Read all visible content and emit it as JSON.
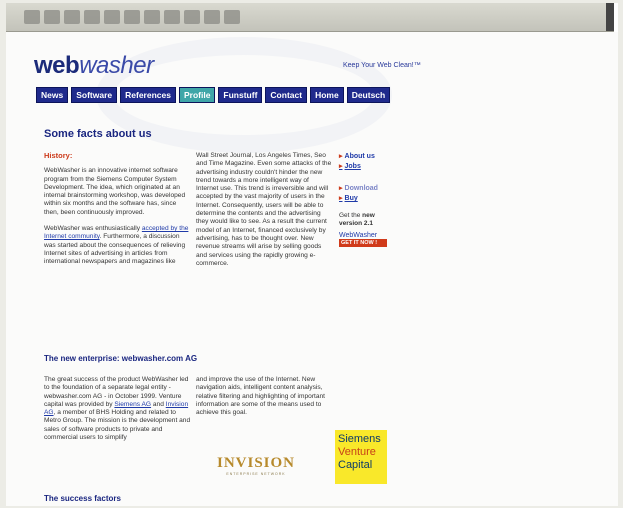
{
  "header": {
    "logo_main": "web",
    "logo_rest": "washer",
    "tagline": "Keep Your Web Clean!™"
  },
  "nav": [
    {
      "label": "News"
    },
    {
      "label": "Software"
    },
    {
      "label": "References"
    },
    {
      "label": "Profile",
      "active": true
    },
    {
      "label": "Funstuff"
    },
    {
      "label": "Contact"
    },
    {
      "label": "Home"
    },
    {
      "label": "Deutsch"
    }
  ],
  "main": {
    "heading": "Some facts about us",
    "history_title": "History:",
    "col1_p1": "WebWasher is an innovative internet software program from the Siemens Computer System Development. The idea, which originated at an internal brainstorming workshop, was developed within six months and the software has, since then, been continuously improved.",
    "col1_p2_start": "WebWasher was enthusiastically",
    "col1_p2_link": "accepted by the Internet community",
    "col1_p2_end": ". Furthermore, a discussion was started about the consequences of relieving Internet sites of advertising in articles from international newspapers and magazines like",
    "col2_p1": "Wall Street Journal, Los Angeles Times, Seo and Time Magazine. Even some attacks of the advertising industry couldn't hinder the new trend towards a more intelligent way of Internet use. This trend is irreversible and will accepted by the vast majority of users in the Internet. Consequently, users will be able to determine the contents and the advertising they would like to see. As a result the current model of an Internet, financed exclusively by advertising, has to be thought over. New revenue streams will arise by selling goods and services using the rapidly growing e-commerce."
  },
  "sidebar": {
    "items": [
      {
        "label": "About us"
      },
      {
        "label": "Jobs"
      },
      {
        "label": "Download"
      },
      {
        "label": "Buy"
      }
    ],
    "get_text_1": "Get the",
    "get_text_bold": "new version 2.1",
    "badge_name": "WebWasher",
    "badge_cta": "GET IT NOW !"
  },
  "section2": {
    "title": "The new enterprise: webwasher.com AG",
    "col1_start": "The great success of the product WebWasher led to the foundation of a separate legal entity - webwasher.com AG - in October 1999. Venture capital was provided by",
    "col1_link1": "Siemens AG",
    "col1_and": "and",
    "col1_link2": "Invision AG",
    "col1_end": ", a member of BHS Holding and related to Metro Group. The mission is the development and sales of software products to private and commercial users to simplify",
    "col2": "and improve the use of the Internet. New navigation aids, intelligent content analysis, relative filtering and highlighting of important information are some of the means used to achieve this goal.",
    "invision_big": "INVISION",
    "invision_small": "ENTERPRISE NETWORK",
    "siemens_1": "Siemens",
    "siemens_2": "Venture",
    "siemens_3": "Capital"
  },
  "section3": {
    "title": "The success factors"
  }
}
